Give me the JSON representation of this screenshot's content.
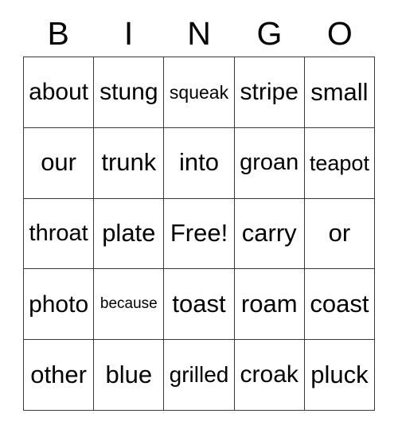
{
  "card": {
    "title": "BINGO",
    "header_letters": [
      "B",
      "I",
      "N",
      "G",
      "O"
    ],
    "free_space_label": "Free!",
    "free_space_position": {
      "row": 2,
      "col": 2
    },
    "grid_size": {
      "rows": 5,
      "cols": 5
    },
    "colors": {
      "background": "#ffffff",
      "text": "#000000",
      "border": "#3a3a3a"
    },
    "rows": [
      {
        "cells": [
          {
            "word": "about"
          },
          {
            "word": "stung"
          },
          {
            "word": "squeak"
          },
          {
            "word": "stripe"
          },
          {
            "word": "small"
          }
        ]
      },
      {
        "cells": [
          {
            "word": "our"
          },
          {
            "word": "trunk"
          },
          {
            "word": "into"
          },
          {
            "word": "groan"
          },
          {
            "word": "teapot"
          }
        ]
      },
      {
        "cells": [
          {
            "word": "throat"
          },
          {
            "word": "plate"
          },
          {
            "word": "Free!"
          },
          {
            "word": "carry"
          },
          {
            "word": "or"
          }
        ]
      },
      {
        "cells": [
          {
            "word": "photo"
          },
          {
            "word": "because"
          },
          {
            "word": "toast"
          },
          {
            "word": "roam"
          },
          {
            "word": "coast"
          }
        ]
      },
      {
        "cells": [
          {
            "word": "other"
          },
          {
            "word": "blue"
          },
          {
            "word": "grilled"
          },
          {
            "word": "croak"
          },
          {
            "word": "pluck"
          }
        ]
      }
    ]
  }
}
